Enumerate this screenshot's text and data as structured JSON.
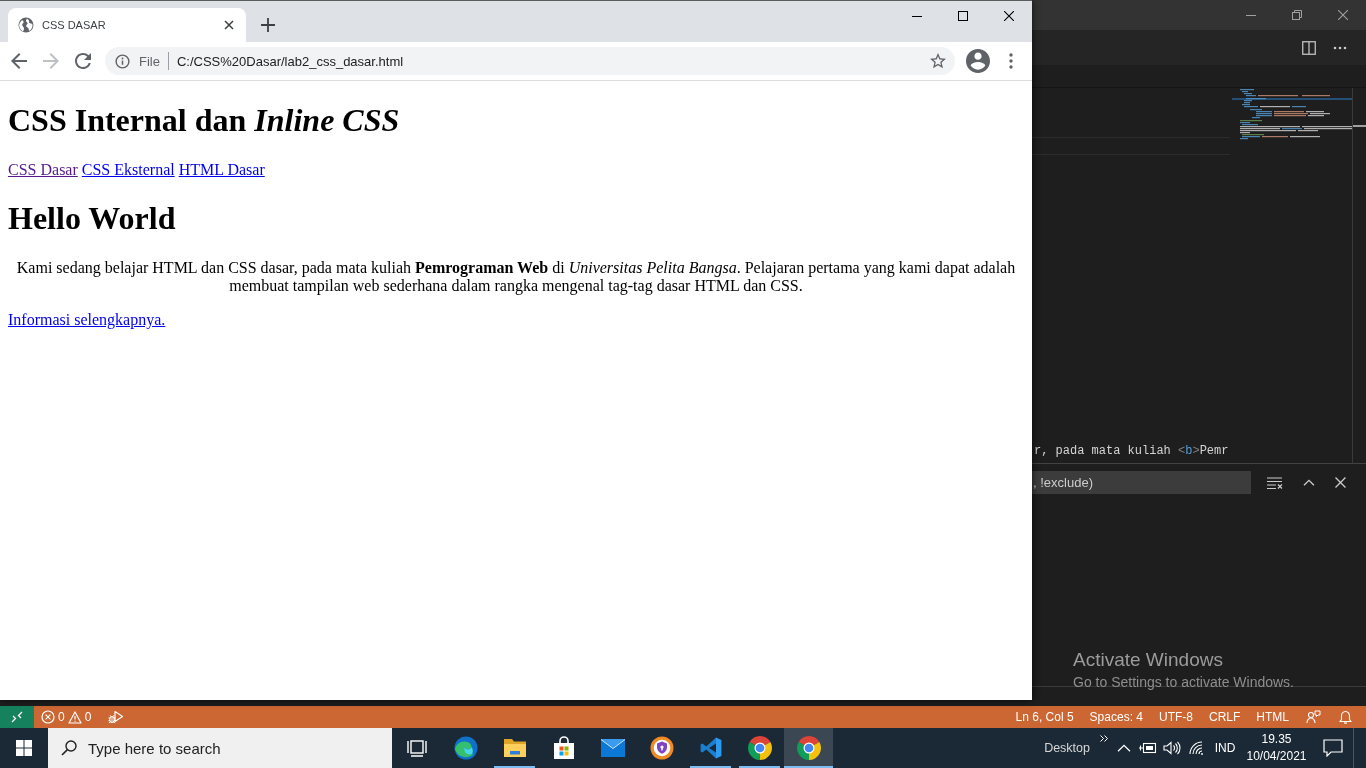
{
  "vscode": {
    "editor": {
      "code_line": [
        {
          "text": "r, pada mata kuliah ",
          "kind": "text"
        },
        {
          "text": "<",
          "kind": "bracket"
        },
        {
          "text": "b",
          "kind": "tag"
        },
        {
          "text": ">",
          "kind": "bracket"
        },
        {
          "text": "Pemr",
          "kind": "text"
        }
      ]
    },
    "panel": {
      "filter": {
        "value": ", !exclude)"
      }
    },
    "status_bar": {
      "problems": {
        "errors": "0",
        "warnings": "0"
      },
      "items": [
        "Ln 6, Col 5",
        "Spaces: 4",
        "UTF-8",
        "CRLF",
        "HTML"
      ]
    }
  },
  "browser": {
    "tabs": [
      {
        "title": "CSS DASAR",
        "selected": true
      }
    ],
    "nav_buttons": [
      {
        "kind": "back",
        "disabled": false
      },
      {
        "kind": "forward",
        "disabled": true
      },
      {
        "kind": "reload",
        "disabled": false
      }
    ],
    "address": {
      "scheme": "File",
      "url": "C:/CSS%20Dasar/lab2_css_dasar.html"
    },
    "page": {
      "heading": "CSS Internal dan *Inline CSS*",
      "nav_links": [
        {
          "label": "CSS Dasar",
          "visited": true
        },
        {
          "label": "CSS Eksternal",
          "visited": false
        },
        {
          "label": "HTML Dasar",
          "visited": false
        }
      ],
      "subheading": "Hello World",
      "paragraph": "Kami sedang belajar HTML dan CSS dasar, pada mata kuliah **Pemrograman Web** di *Universitas Pelita Bangsa*. Pelajaran pertama yang kami dapat adalah membuat tampilan web sederhana dalam rangka mengenal tag-tag dasar HTML dan CSS.",
      "more_link": {
        "label": "Informasi selengkapnya.",
        "visited": false
      }
    }
  },
  "activation_notice": {
    "title": "Activate Windows",
    "message": "Go to Settings to activate Windows."
  },
  "taskbar": {
    "search": {
      "placeholder": "Type here to search"
    },
    "apps": [
      {
        "kind": "task-view",
        "running": false,
        "selected": false
      },
      {
        "kind": "edge",
        "running": false,
        "selected": false
      },
      {
        "kind": "explorer",
        "running": true,
        "selected": false
      },
      {
        "kind": "store",
        "running": false,
        "selected": false
      },
      {
        "kind": "mail",
        "running": false,
        "selected": false
      },
      {
        "kind": "shield",
        "running": false,
        "selected": false
      },
      {
        "kind": "vscode",
        "running": true,
        "selected": false
      },
      {
        "kind": "chrome",
        "running": true,
        "selected": false
      },
      {
        "kind": "chrome",
        "running": true,
        "selected": true
      }
    ],
    "tray": {
      "toolbar_label": "Desktop",
      "language": "IND",
      "time": "19.35",
      "date": "10/04/2021"
    }
  }
}
